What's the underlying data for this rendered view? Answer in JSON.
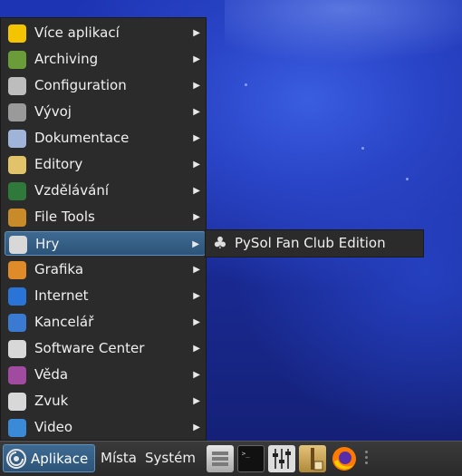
{
  "menu": {
    "items": [
      {
        "label": "Více aplikací",
        "icon": "more-apps-icon",
        "color": "#f5c400"
      },
      {
        "label": "Archiving",
        "icon": "archive-icon",
        "color": "#6a9d3a"
      },
      {
        "label": "Configuration",
        "icon": "configuration-icon",
        "color": "#bdbdbd"
      },
      {
        "label": "Vývoj",
        "icon": "hammer-icon",
        "color": "#9a9a9a"
      },
      {
        "label": "Dokumentace",
        "icon": "documentation-icon",
        "color": "#9fb4d8"
      },
      {
        "label": "Editory",
        "icon": "editor-icon",
        "color": "#e2c36a"
      },
      {
        "label": "Vzdělávání",
        "icon": "education-icon",
        "color": "#2f7a3a"
      },
      {
        "label": "File Tools",
        "icon": "file-tools-icon",
        "color": "#c98a2a"
      },
      {
        "label": "Hry",
        "icon": "games-icon",
        "color": "#d8d8d8",
        "active": true
      },
      {
        "label": "Grafika",
        "icon": "graphics-icon",
        "color": "#e08b2a"
      },
      {
        "label": "Internet",
        "icon": "internet-icon",
        "color": "#2a74d8"
      },
      {
        "label": "Kancelář",
        "icon": "office-icon",
        "color": "#3a7ad0"
      },
      {
        "label": "Software Center",
        "icon": "software-center-icon",
        "color": "#d8d8d8"
      },
      {
        "label": "Věda",
        "icon": "science-icon",
        "color": "#a04aa0"
      },
      {
        "label": "Zvuk",
        "icon": "sound-icon",
        "color": "#d8d8d8"
      },
      {
        "label": "Video",
        "icon": "video-icon",
        "color": "#3a8ad8"
      }
    ]
  },
  "submenu": {
    "items": [
      {
        "label": "PySol Fan Club Edition",
        "icon": "club-card-icon"
      }
    ]
  },
  "panel": {
    "applications_label": "Aplikace",
    "places_label": "Místa",
    "system_label": "Systém",
    "launchers": [
      {
        "icon": "file-manager-icon",
        "color": "#cfcfcf"
      },
      {
        "icon": "terminal-icon",
        "color": "#1a1a1a"
      },
      {
        "icon": "settings-mixer-icon",
        "color": "#bdbdbd"
      },
      {
        "icon": "archive-manager-icon",
        "color": "#c9a04a"
      },
      {
        "icon": "firefox-icon",
        "color": "#ff6a00"
      }
    ]
  }
}
